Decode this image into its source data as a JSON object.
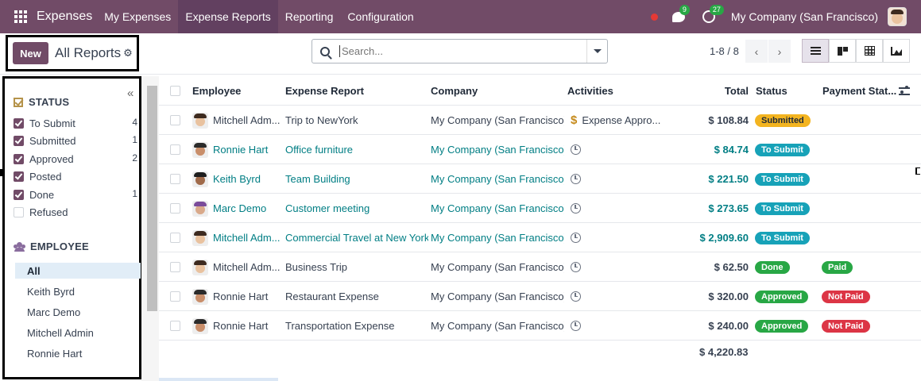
{
  "navbar": {
    "brand": "Expenses",
    "menu": [
      {
        "label": "My Expenses",
        "active": false
      },
      {
        "label": "Expense Reports",
        "active": true
      },
      {
        "label": "Reporting",
        "active": false
      },
      {
        "label": "Configuration",
        "active": false
      }
    ],
    "messages_count": "9",
    "activities_count": "27",
    "company": "My Company (San Francisco)"
  },
  "control_panel": {
    "new_label": "New",
    "title": "All Reports",
    "search_placeholder": "Search...",
    "pager": "1-8 / 8"
  },
  "sidebar": {
    "status_title": "STATUS",
    "status_items": [
      {
        "label": "To Submit",
        "count": "4",
        "checked": true
      },
      {
        "label": "Submitted",
        "count": "1",
        "checked": true
      },
      {
        "label": "Approved",
        "count": "2",
        "checked": true
      },
      {
        "label": "Posted",
        "count": "",
        "checked": true
      },
      {
        "label": "Done",
        "count": "1",
        "checked": true
      },
      {
        "label": "Refused",
        "count": "",
        "checked": false
      }
    ],
    "employee_title": "EMPLOYEE",
    "employee_items": [
      {
        "label": "All",
        "active": true
      },
      {
        "label": "Keith Byrd",
        "active": false
      },
      {
        "label": "Marc Demo",
        "active": false
      },
      {
        "label": "Mitchell Admin",
        "active": false
      },
      {
        "label": "Ronnie Hart",
        "active": false
      }
    ]
  },
  "table": {
    "headers": {
      "employee": "Employee",
      "report": "Expense Report",
      "company": "Company",
      "activities": "Activities",
      "total": "Total",
      "status": "Status",
      "payment": "Payment Stat..."
    },
    "rows": [
      {
        "employee": "Mitchell Adm...",
        "report": "Trip to NewYork",
        "company": "My Company (San Francisco)",
        "activity": "Expense Appro...",
        "total": "$ 108.84",
        "status": "Submitted",
        "payment": "",
        "highlight": false
      },
      {
        "employee": "Ronnie Hart",
        "report": "Office furniture",
        "company": "My Company (San Francisco)",
        "activity": "",
        "total": "$ 84.74",
        "status": "To Submit",
        "payment": "",
        "highlight": true
      },
      {
        "employee": "Keith Byrd",
        "report": "Team Building",
        "company": "My Company (San Francisco)",
        "activity": "",
        "total": "$ 221.50",
        "status": "To Submit",
        "payment": "",
        "highlight": true
      },
      {
        "employee": "Marc Demo",
        "report": "Customer meeting",
        "company": "My Company (San Francisco)",
        "activity": "",
        "total": "$ 273.65",
        "status": "To Submit",
        "payment": "",
        "highlight": true
      },
      {
        "employee": "Mitchell Adm...",
        "report": "Commercial Travel at New York",
        "company": "My Company (San Francisco)",
        "activity": "",
        "total": "$ 2,909.60",
        "status": "To Submit",
        "payment": "",
        "highlight": true
      },
      {
        "employee": "Mitchell Adm...",
        "report": "Business Trip",
        "company": "My Company (San Francisco)",
        "activity": "",
        "total": "$ 62.50",
        "status": "Done",
        "payment": "Paid",
        "highlight": false
      },
      {
        "employee": "Ronnie Hart",
        "report": "Restaurant Expense",
        "company": "My Company (San Francisco)",
        "activity": "",
        "total": "$ 320.00",
        "status": "Approved",
        "payment": "Not Paid",
        "highlight": false
      },
      {
        "employee": "Ronnie Hart",
        "report": "Transportation Expense",
        "company": "My Company (San Francisco)",
        "activity": "",
        "total": "$ 240.00",
        "status": "Approved",
        "payment": "Not Paid",
        "highlight": false
      }
    ],
    "grand_total": "$ 4,220.83"
  },
  "colors": {
    "brand": "#714b67",
    "link": "#017e84",
    "submitted": "#f3b420",
    "to_submit": "#17a2b8",
    "approved": "#28a745",
    "not_paid": "#dc3545"
  }
}
